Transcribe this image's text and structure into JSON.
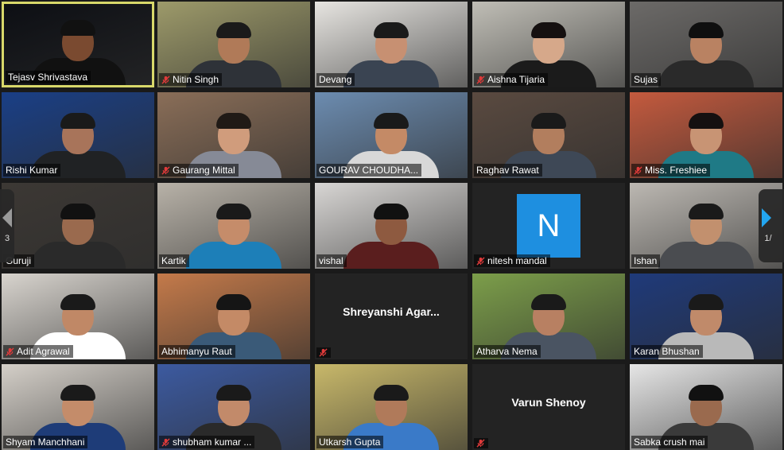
{
  "participants": [
    {
      "name": "Tejasv Shrivastava",
      "muted": false,
      "active": true,
      "bg": "#0d0f14",
      "skin": "#7a4a30",
      "shirt": "#111111",
      "hair": "#111111"
    },
    {
      "name": "Nitin Singh",
      "muted": true,
      "bg": "#9d9a6a",
      "skin": "#b07a58",
      "shirt": "#2e3238",
      "hair": "#1a1a1a"
    },
    {
      "name": "Devang",
      "muted": false,
      "bg": "#e7e5e1",
      "skin": "#c79072",
      "shirt": "#3a4452",
      "hair": "#1a1a1a"
    },
    {
      "name": "Aishna Tijaria",
      "muted": true,
      "bg": "#c0beb6",
      "skin": "#d6a88a",
      "shirt": "#1b1b1b",
      "hair": "#151010"
    },
    {
      "name": "Sujas",
      "muted": false,
      "bg": "#6c6a68",
      "skin": "#b98262",
      "shirt": "#2a2a2a",
      "hair": "#0f0f0f"
    },
    {
      "name": "Rishi Kumar",
      "muted": false,
      "bg": "#1a3f86",
      "skin": "#a8745a",
      "shirt": "#202224",
      "hair": "#1a1a1a"
    },
    {
      "name": "Gaurang Mittal",
      "muted": true,
      "bg": "#8a6e58",
      "skin": "#d09c7c",
      "shirt": "#868a96",
      "hair": "#201a16"
    },
    {
      "name": "GOURAV CHOUDHA...",
      "muted": false,
      "bg": "#6c8cb0",
      "skin": "#c48a66",
      "shirt": "#d8d8d8",
      "hair": "#1a1a1a"
    },
    {
      "name": "Raghav Rawat",
      "muted": false,
      "bg": "#5a4a40",
      "skin": "#b27e5e",
      "shirt": "#3e4856",
      "hair": "#1a1a1a"
    },
    {
      "name": "Miss. Freshiee",
      "muted": true,
      "bg": "#c45a3e",
      "skin": "#c89474",
      "shirt": "#1f7a86",
      "hair": "#151010"
    },
    {
      "name": "Guruji",
      "muted": false,
      "bg": "#3c3834",
      "skin": "#9a6a4e",
      "shirt": "#2a2a2a",
      "hair": "#111111"
    },
    {
      "name": "Kartik",
      "muted": false,
      "bg": "#b8b2a8",
      "skin": "#c58c6a",
      "shirt": "#1d7fb8",
      "hair": "#1a1a1a"
    },
    {
      "name": "vishal",
      "muted": false,
      "bg": "#d8d6d4",
      "skin": "#8e5a40",
      "shirt": "#5a1e1e",
      "hair": "#111111"
    },
    {
      "name": "nitesh mandal",
      "muted": true,
      "avatar": "N",
      "bg": "#232323"
    },
    {
      "name": "Ishan",
      "muted": false,
      "bg": "#bcb8b2",
      "skin": "#c2906e",
      "shirt": "#4a4c50",
      "hair": "#1a1a1a"
    },
    {
      "name": "Adit Agrawal",
      "muted": true,
      "bg": "#d8d4ce",
      "skin": "#c08866",
      "shirt": "#ffffff",
      "hair": "#1a1a1a"
    },
    {
      "name": "Abhimanyu Raut",
      "muted": false,
      "bg": "#c47a4a",
      "skin": "#c48a66",
      "shirt": "#3a5a78",
      "hair": "#151515"
    },
    {
      "name": "Shreyanshi  Agar...",
      "muted": true,
      "label_only": true,
      "bg": "#232323"
    },
    {
      "name": "Atharva Nema",
      "muted": false,
      "bg": "#7c9e4a",
      "skin": "#b88062",
      "shirt": "#4a5462",
      "hair": "#1a1a1a"
    },
    {
      "name": "Karan Bhushan",
      "muted": false,
      "bg": "#1f3a7a",
      "skin": "#c08a6a",
      "shirt": "#b9b9b9",
      "hair": "#1a1a1a"
    },
    {
      "name": "Shyam Manchhani",
      "muted": false,
      "bg": "#d4cfc8",
      "skin": "#c48c6a",
      "shirt": "#1e3c78",
      "hair": "#1a1a1a"
    },
    {
      "name": "shubham kumar ...",
      "muted": true,
      "bg": "#3c5aa0",
      "skin": "#c28a6a",
      "shirt": "#2a2a2a",
      "hair": "#1a1a1a"
    },
    {
      "name": "Utkarsh Gupta",
      "muted": false,
      "bg": "#c8b86a",
      "skin": "#b07a5a",
      "shirt": "#3a7ac8",
      "hair": "#1a1a1a"
    },
    {
      "name": "Varun Shenoy",
      "muted": true,
      "label_only": true,
      "bg": "#232323"
    },
    {
      "name": "Sabka crush mai",
      "muted": false,
      "bg": "#e6e6e6",
      "skin": "#9a6a4e",
      "shirt": "#3a3a3a",
      "hair": "#111111"
    }
  ],
  "nav": {
    "left_page": "3",
    "right_page": "1/"
  },
  "colors": {
    "mute": "#e03a3a",
    "active_border": "#d8d86a",
    "avatar": "#1e8fe0"
  }
}
